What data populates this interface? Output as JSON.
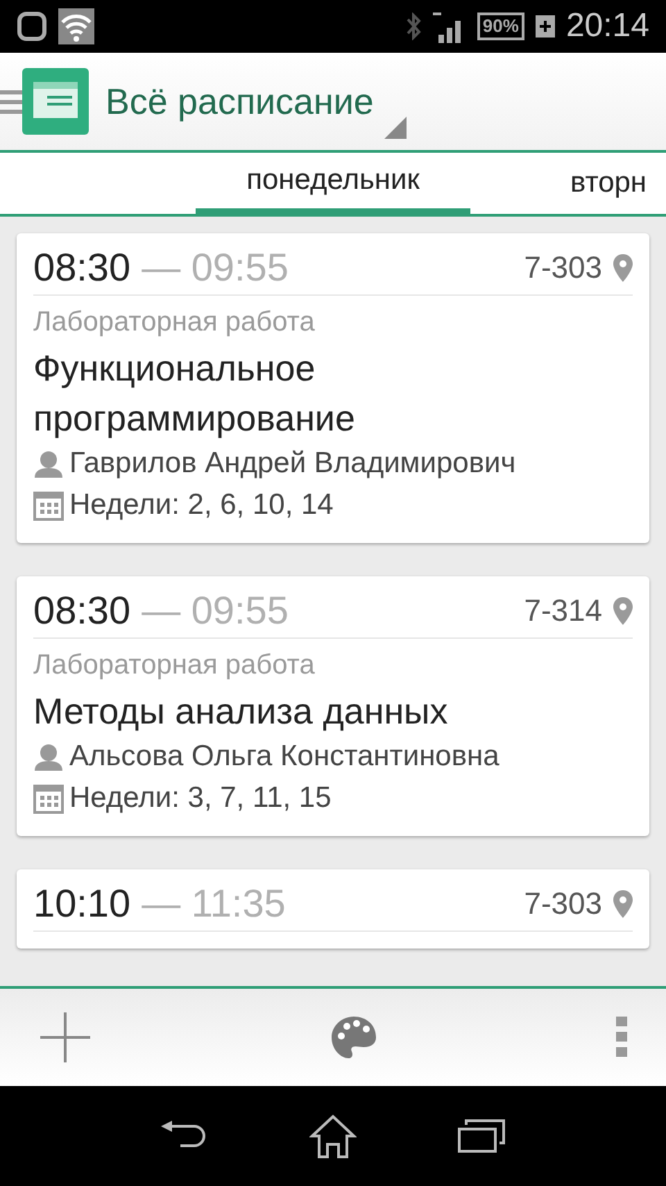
{
  "status_bar": {
    "battery": "90%",
    "time": "20:14"
  },
  "action_bar": {
    "title": "Всё расписание"
  },
  "tabs": [
    {
      "label": "понедельник",
      "selected": true
    },
    {
      "label": "вторн",
      "selected": false
    }
  ],
  "lessons": [
    {
      "start": "08:30",
      "end": "— 09:55",
      "room": "7-303",
      "type": "Лабораторная работа",
      "subject": "Функциональное программирование",
      "teacher": "Гаврилов Андрей Владимирович",
      "weeks": "Недели: 2, 6, 10, 14"
    },
    {
      "start": "08:30",
      "end": "— 09:55",
      "room": "7-314",
      "type": "Лабораторная работа",
      "subject": "Методы анализа данных",
      "teacher": "Альсова Ольга Константиновна",
      "weeks": "Недели: 3, 7, 11, 15"
    },
    {
      "start": "10:10",
      "end": "— 11:35",
      "room": "7-303"
    }
  ]
}
